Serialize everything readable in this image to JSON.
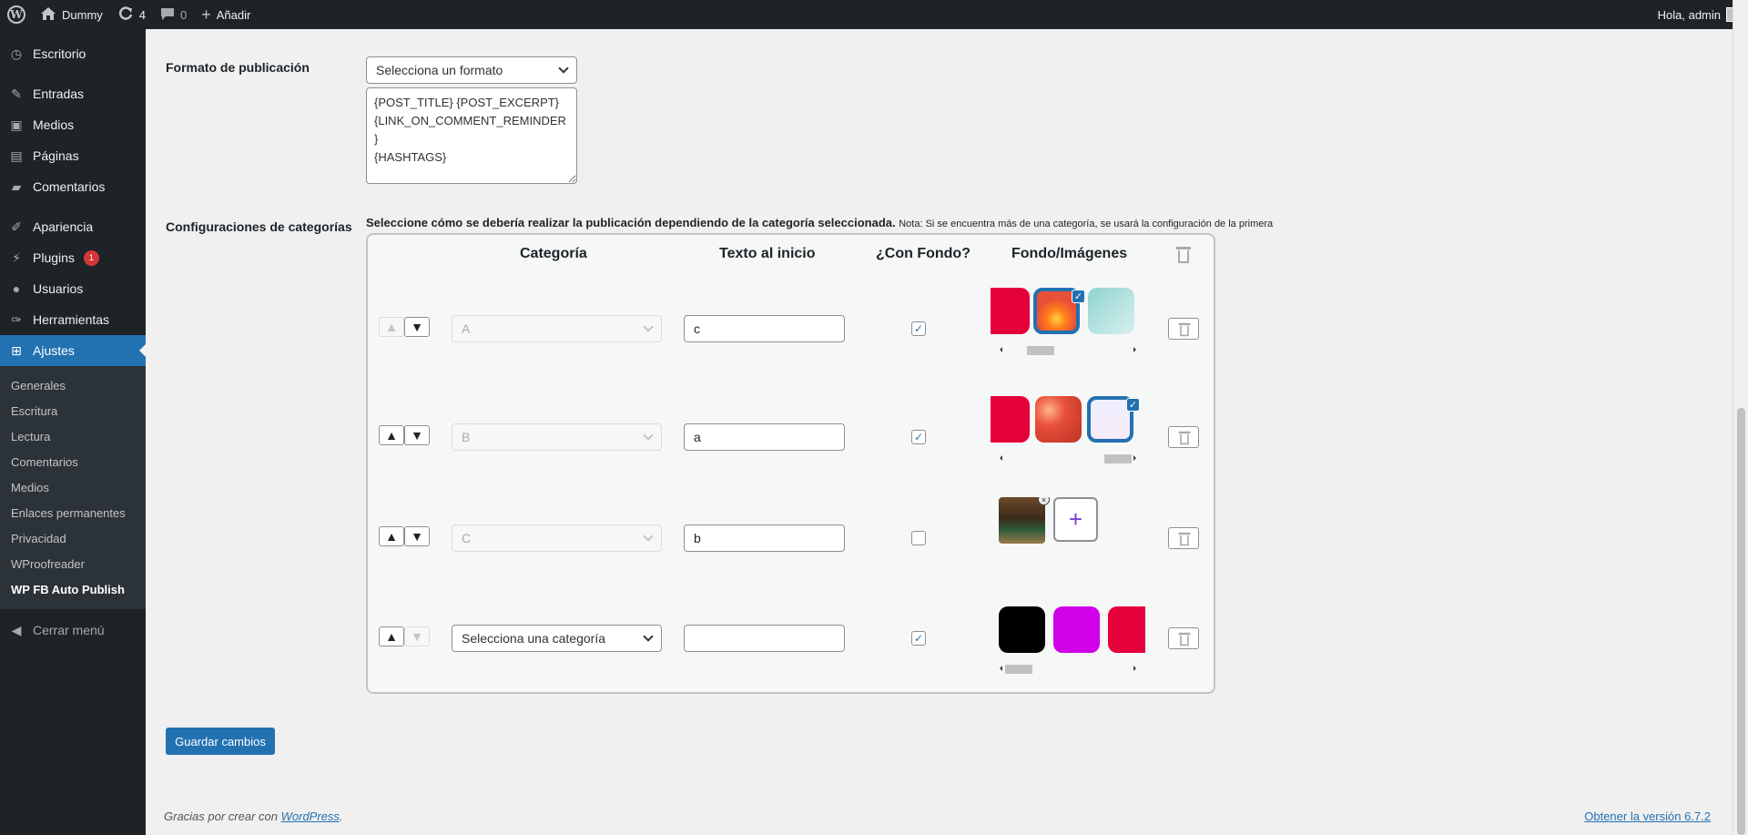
{
  "adminbar": {
    "site_name": "Dummy",
    "updates_count": "4",
    "comments_count": "0",
    "add_new_label": "Añadir",
    "greeting": "Hola, admin"
  },
  "sidebar": {
    "items": [
      {
        "label": "Escritorio",
        "icon": "dashboard-icon"
      },
      {
        "label": "Entradas",
        "icon": "pin-icon"
      },
      {
        "label": "Medios",
        "icon": "media-icon"
      },
      {
        "label": "Páginas",
        "icon": "page-icon"
      },
      {
        "label": "Comentarios",
        "icon": "comment-icon"
      },
      {
        "label": "Apariencia",
        "icon": "brush-icon"
      },
      {
        "label": "Plugins",
        "icon": "plugin-icon",
        "badge": "1"
      },
      {
        "label": "Usuarios",
        "icon": "user-icon"
      },
      {
        "label": "Herramientas",
        "icon": "wrench-icon"
      },
      {
        "label": "Ajustes",
        "icon": "settings-icon"
      }
    ],
    "submenu": [
      "Generales",
      "Escritura",
      "Lectura",
      "Comentarios",
      "Medios",
      "Enlaces permanentes",
      "Privacidad",
      "WProofreader",
      "WP FB Auto Publish"
    ],
    "collapse_label": "Cerrar menú"
  },
  "form": {
    "format_label": "Formato de publicación",
    "format_select": "Selecciona un formato",
    "format_text": "{POST_TITLE} {POST_EXCERPT}\n{LINK_ON_COMMENT_REMINDER}\n{HASHTAGS}",
    "categories_label": "Configuraciones de categorías",
    "categories_desc": "Seleccione cómo se debería realizar la publicación dependiendo de la categoría seleccionada.",
    "categories_note": "Nota: Si se encuentra más de una categoría, se usará la configuración de la primera"
  },
  "table": {
    "headers": {
      "category": "Categoría",
      "text": "Texto al inicio",
      "background": "¿Con Fondo?",
      "images": "Fondo/Imágenes"
    },
    "rows": [
      {
        "category": "A",
        "text": "c",
        "with_background": true
      },
      {
        "category": "B",
        "text": "a",
        "with_background": true
      },
      {
        "category": "C",
        "text": "b",
        "with_background": false
      },
      {
        "category": "Selecciona una categoría",
        "text": "",
        "with_background": true
      }
    ],
    "add_image_symbol": "+"
  },
  "save_label": "Guardar cambios",
  "footer": {
    "thanks_prefix": "Gracias por crear con ",
    "wordpress_link": "WordPress",
    "thanks_suffix": ".",
    "version_link": "Obtener la versión 6.7.2"
  },
  "colors": {
    "accent": "#2271b1",
    "sidebar_bg": "#1d2327",
    "crimson": "#e4003a",
    "magenta": "#d000e8"
  }
}
